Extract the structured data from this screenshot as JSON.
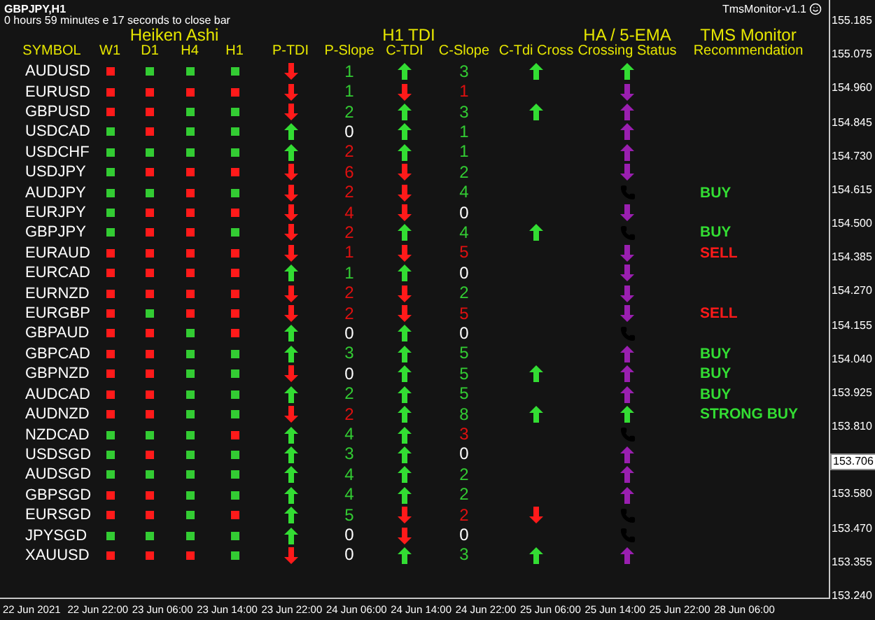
{
  "chart": {
    "symbol": "GBPJPY,H1",
    "countdown": "0 hours 59 minutes e 17 seconds to close bar",
    "indicator": "TmsMonitor-v1.1"
  },
  "groups": [
    "Heiken Ashi",
    "H1 TDI",
    "HA / 5-EMA",
    "TMS Monitor"
  ],
  "columns": [
    "SYMBOL",
    "W1",
    "D1",
    "H4",
    "H1",
    "P-TDI",
    "P-Slope",
    "C-TDI",
    "C-Slope",
    "C-Tdi Cross",
    "Crossing Status",
    "Recommendation"
  ],
  "rows": [
    {
      "symbol": "AUDUSD",
      "ha": [
        false,
        true,
        true,
        true
      ],
      "p_tdi_up": false,
      "p_slope": {
        "text": "1",
        "color": "#33cc33"
      },
      "c_tdi_up": true,
      "c_slope": {
        "text": "3",
        "color": "#33cc33"
      },
      "cross_up": true,
      "status": {
        "kind": "strong_up"
      }
    },
    {
      "symbol": "EURUSD",
      "ha": [
        false,
        false,
        false,
        false
      ],
      "p_tdi_up": false,
      "p_slope": {
        "text": "1",
        "color": "#33cc33"
      },
      "c_tdi_up": false,
      "c_slope": {
        "text": "1",
        "color": "#e01010"
      },
      "status": {
        "kind": "down"
      }
    },
    {
      "symbol": "GBPUSD",
      "ha": [
        false,
        false,
        true,
        true
      ],
      "p_tdi_up": false,
      "p_slope": {
        "text": "2",
        "color": "#33cc33"
      },
      "c_tdi_up": true,
      "c_slope": {
        "text": "3",
        "color": "#33cc33"
      },
      "cross_up": true,
      "status": {
        "kind": "up"
      }
    },
    {
      "symbol": "USDCAD",
      "ha": [
        true,
        false,
        true,
        true
      ],
      "p_tdi_up": true,
      "p_slope": {
        "text": "0",
        "color": "#ffffff"
      },
      "c_tdi_up": true,
      "c_slope": {
        "text": "1",
        "color": "#33cc33"
      },
      "status": {
        "kind": "up"
      }
    },
    {
      "symbol": "USDCHF",
      "ha": [
        true,
        true,
        true,
        true
      ],
      "p_tdi_up": true,
      "p_slope": {
        "text": "2",
        "color": "#e01010"
      },
      "c_tdi_up": true,
      "c_slope": {
        "text": "1",
        "color": "#33cc33"
      },
      "status": {
        "kind": "up"
      }
    },
    {
      "symbol": "USDJPY",
      "ha": [
        true,
        false,
        false,
        false
      ],
      "p_tdi_up": false,
      "p_slope": {
        "text": "6",
        "color": "#e01010"
      },
      "c_tdi_up": false,
      "c_slope": {
        "text": "2",
        "color": "#33cc33"
      },
      "status": {
        "kind": "down"
      }
    },
    {
      "symbol": "AUDJPY",
      "ha": [
        true,
        true,
        false,
        true
      ],
      "p_tdi_up": false,
      "p_slope": {
        "text": "2",
        "color": "#e01010"
      },
      "c_tdi_up": false,
      "c_slope": {
        "text": "4",
        "color": "#33cc33"
      },
      "status": {
        "kind": "phone"
      },
      "recommendation": {
        "text": "BUY",
        "color": "#33dd33"
      }
    },
    {
      "symbol": "EURJPY",
      "ha": [
        true,
        false,
        false,
        false
      ],
      "p_tdi_up": false,
      "p_slope": {
        "text": "4",
        "color": "#e01010"
      },
      "c_tdi_up": false,
      "c_slope": {
        "text": "0",
        "color": "#ffffff"
      },
      "status": {
        "kind": "down"
      }
    },
    {
      "symbol": "GBPJPY",
      "ha": [
        true,
        false,
        false,
        true
      ],
      "p_tdi_up": false,
      "p_slope": {
        "text": "2",
        "color": "#e01010"
      },
      "c_tdi_up": true,
      "c_slope": {
        "text": "4",
        "color": "#33cc33"
      },
      "cross_up": true,
      "status": {
        "kind": "phone"
      },
      "recommendation": {
        "text": "BUY",
        "color": "#33dd33"
      }
    },
    {
      "symbol": "EURAUD",
      "ha": [
        false,
        false,
        false,
        false
      ],
      "p_tdi_up": false,
      "p_slope": {
        "text": "1",
        "color": "#e01010"
      },
      "c_tdi_up": false,
      "c_slope": {
        "text": "5",
        "color": "#e01010"
      },
      "status": {
        "kind": "down"
      },
      "recommendation": {
        "text": "SELL",
        "color": "#ff1a1a"
      }
    },
    {
      "symbol": "EURCAD",
      "ha": [
        false,
        false,
        false,
        false
      ],
      "p_tdi_up": true,
      "p_slope": {
        "text": "1",
        "color": "#33cc33"
      },
      "c_tdi_up": true,
      "c_slope": {
        "text": "0",
        "color": "#ffffff"
      },
      "status": {
        "kind": "down"
      }
    },
    {
      "symbol": "EURNZD",
      "ha": [
        false,
        false,
        false,
        false
      ],
      "p_tdi_up": false,
      "p_slope": {
        "text": "2",
        "color": "#e01010"
      },
      "c_tdi_up": false,
      "c_slope": {
        "text": "2",
        "color": "#33cc33"
      },
      "status": {
        "kind": "down"
      }
    },
    {
      "symbol": "EURGBP",
      "ha": [
        false,
        true,
        false,
        false
      ],
      "p_tdi_up": false,
      "p_slope": {
        "text": "2",
        "color": "#e01010"
      },
      "c_tdi_up": false,
      "c_slope": {
        "text": "5",
        "color": "#e01010"
      },
      "status": {
        "kind": "down"
      },
      "recommendation": {
        "text": "SELL",
        "color": "#ff1a1a"
      }
    },
    {
      "symbol": "GBPAUD",
      "ha": [
        false,
        false,
        true,
        false
      ],
      "p_tdi_up": true,
      "p_slope": {
        "text": "0",
        "color": "#ffffff"
      },
      "c_tdi_up": true,
      "c_slope": {
        "text": "0",
        "color": "#ffffff"
      },
      "status": {
        "kind": "phone"
      }
    },
    {
      "symbol": "GBPCAD",
      "ha": [
        false,
        false,
        true,
        true
      ],
      "p_tdi_up": true,
      "p_slope": {
        "text": "3",
        "color": "#33cc33"
      },
      "c_tdi_up": true,
      "c_slope": {
        "text": "5",
        "color": "#33cc33"
      },
      "status": {
        "kind": "up"
      },
      "recommendation": {
        "text": "BUY",
        "color": "#33dd33"
      }
    },
    {
      "symbol": "GBPNZD",
      "ha": [
        false,
        false,
        true,
        true
      ],
      "p_tdi_up": false,
      "p_slope": {
        "text": "0",
        "color": "#ffffff"
      },
      "c_tdi_up": true,
      "c_slope": {
        "text": "5",
        "color": "#33cc33"
      },
      "cross_up": true,
      "status": {
        "kind": "up"
      },
      "recommendation": {
        "text": "BUY",
        "color": "#33dd33"
      }
    },
    {
      "symbol": "AUDCAD",
      "ha": [
        false,
        false,
        true,
        true
      ],
      "p_tdi_up": true,
      "p_slope": {
        "text": "2",
        "color": "#33cc33"
      },
      "c_tdi_up": true,
      "c_slope": {
        "text": "5",
        "color": "#33cc33"
      },
      "status": {
        "kind": "up"
      },
      "recommendation": {
        "text": "BUY",
        "color": "#33dd33"
      }
    },
    {
      "symbol": "AUDNZD",
      "ha": [
        false,
        false,
        true,
        true
      ],
      "p_tdi_up": false,
      "p_slope": {
        "text": "2",
        "color": "#e01010"
      },
      "c_tdi_up": true,
      "c_slope": {
        "text": "8",
        "color": "#33cc33"
      },
      "cross_up": true,
      "status": {
        "kind": "strong_up"
      },
      "recommendation": {
        "text": "STRONG BUY",
        "color": "#33dd33"
      }
    },
    {
      "symbol": "NZDCAD",
      "ha": [
        true,
        true,
        true,
        false
      ],
      "p_tdi_up": true,
      "p_slope": {
        "text": "4",
        "color": "#33cc33"
      },
      "c_tdi_up": true,
      "c_slope": {
        "text": "3",
        "color": "#e01010"
      },
      "status": {
        "kind": "phone"
      }
    },
    {
      "symbol": "USDSGD",
      "ha": [
        true,
        false,
        true,
        true
      ],
      "p_tdi_up": true,
      "p_slope": {
        "text": "3",
        "color": "#33cc33"
      },
      "c_tdi_up": true,
      "c_slope": {
        "text": "0",
        "color": "#ffffff"
      },
      "status": {
        "kind": "up"
      }
    },
    {
      "symbol": "AUDSGD",
      "ha": [
        true,
        true,
        true,
        true
      ],
      "p_tdi_up": true,
      "p_slope": {
        "text": "4",
        "color": "#33cc33"
      },
      "c_tdi_up": true,
      "c_slope": {
        "text": "2",
        "color": "#33cc33"
      },
      "status": {
        "kind": "up"
      }
    },
    {
      "symbol": "GBPSGD",
      "ha": [
        false,
        false,
        true,
        true
      ],
      "p_tdi_up": true,
      "p_slope": {
        "text": "4",
        "color": "#33cc33"
      },
      "c_tdi_up": true,
      "c_slope": {
        "text": "2",
        "color": "#33cc33"
      },
      "status": {
        "kind": "up"
      }
    },
    {
      "symbol": "EURSGD",
      "ha": [
        false,
        false,
        true,
        false
      ],
      "p_tdi_up": true,
      "p_slope": {
        "text": "5",
        "color": "#33cc33"
      },
      "c_tdi_up": false,
      "c_slope": {
        "text": "2",
        "color": "#e01010"
      },
      "cross_up": false,
      "status": {
        "kind": "phone"
      }
    },
    {
      "symbol": "JPYSGD",
      "ha": [
        true,
        true,
        true,
        true
      ],
      "p_tdi_up": true,
      "p_slope": {
        "text": "0",
        "color": "#ffffff"
      },
      "c_tdi_up": false,
      "c_slope": {
        "text": "0",
        "color": "#ffffff"
      },
      "status": {
        "kind": "phone"
      }
    },
    {
      "symbol": "XAUUSD",
      "ha": [
        false,
        false,
        false,
        true
      ],
      "p_tdi_up": false,
      "p_slope": {
        "text": "0",
        "color": "#ffffff"
      },
      "c_tdi_up": true,
      "c_slope": {
        "text": "3",
        "color": "#33cc33"
      },
      "cross_up": true,
      "status": {
        "kind": "up"
      }
    }
  ],
  "price_axis": [
    {
      "text": "155.185",
      "current": false
    },
    {
      "text": "155.075",
      "current": false
    },
    {
      "text": "154.960",
      "current": false
    },
    {
      "text": "154.845",
      "current": false
    },
    {
      "text": "154.730",
      "current": false
    },
    {
      "text": "154.615",
      "current": false
    },
    {
      "text": "154.500",
      "current": false
    },
    {
      "text": "154.385",
      "current": false
    },
    {
      "text": "154.270",
      "current": false
    },
    {
      "text": "154.155",
      "current": false
    },
    {
      "text": "154.040",
      "current": false
    },
    {
      "text": "153.925",
      "current": false
    },
    {
      "text": "153.810",
      "current": false
    },
    {
      "text": "153.706",
      "current": true
    },
    {
      "text": "153.580",
      "current": false
    },
    {
      "text": "153.470",
      "current": false
    },
    {
      "text": "153.355",
      "current": false
    },
    {
      "text": "153.240",
      "current": false
    }
  ],
  "time_axis": [
    "22 Jun 2021",
    "22 Jun 22:00",
    "23 Jun 06:00",
    "23 Jun 14:00",
    "23 Jun 22:00",
    "24 Jun 06:00",
    "24 Jun 14:00",
    "24 Jun 22:00",
    "25 Jun 06:00",
    "25 Jun 14:00",
    "25 Jun 22:00",
    "28 Jun 06:00"
  ]
}
